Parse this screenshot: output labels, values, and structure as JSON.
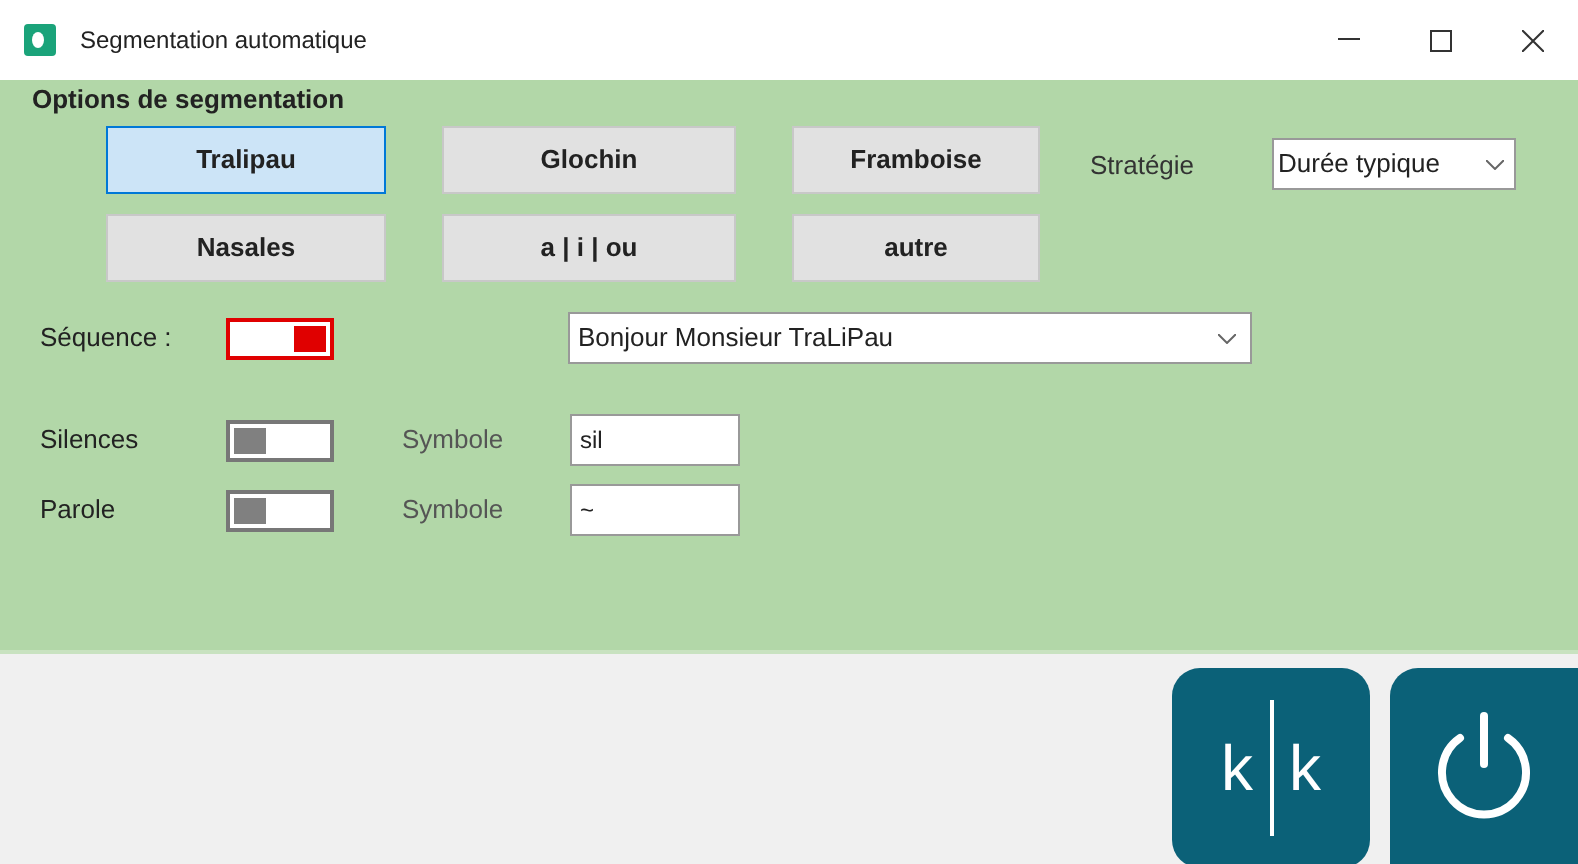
{
  "window": {
    "title": "Segmentation automatique"
  },
  "options": {
    "title": "Options de segmentation",
    "buttons": [
      {
        "label": "Tralipau",
        "selected": true
      },
      {
        "label": "Glochin",
        "selected": false
      },
      {
        "label": "Framboise",
        "selected": false
      },
      {
        "label": "Nasales",
        "selected": false
      },
      {
        "label": "a | i | ou",
        "selected": false
      },
      {
        "label": "autre",
        "selected": false
      }
    ],
    "strategy": {
      "label": "Stratégie",
      "value": "Durée typique"
    },
    "sequence": {
      "label": "Séquence :",
      "on": true,
      "value": "Bonjour Monsieur TraLiPau"
    },
    "switches": [
      {
        "label": "Silences",
        "on": false,
        "symbol_label": "Symbole",
        "symbol": "sil"
      },
      {
        "label": "Parole",
        "on": false,
        "symbol_label": "Symbole",
        "symbol": "~"
      }
    ]
  },
  "footer": {
    "split_button": {
      "left": "k",
      "right": "k"
    }
  }
}
